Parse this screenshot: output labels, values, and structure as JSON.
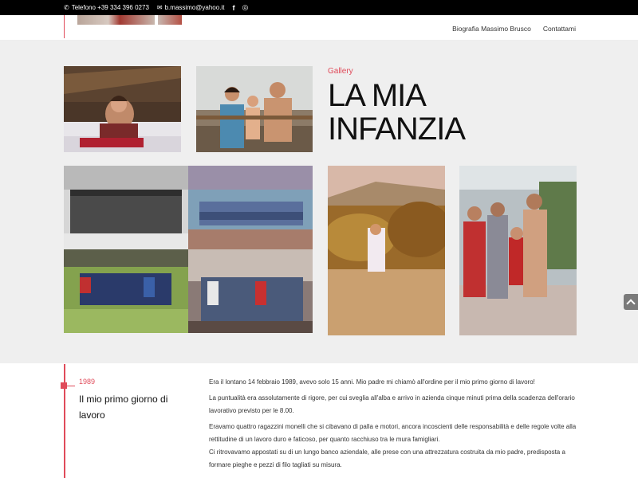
{
  "topbar": {
    "phone": "Telefono +39 334 396 0273",
    "email": "b.massimo@yahoo.it",
    "facebook_glyph": "f",
    "instagram_glyph": "◎"
  },
  "nav": {
    "items": [
      "Biografia Massimo Brusco",
      "Contattami"
    ]
  },
  "gallery": {
    "label": "Gallery",
    "title_line1": "LA MIA",
    "title_line2": "INFANZIA"
  },
  "section": {
    "year": "1989",
    "title": "Il mio primo giorno di lavoro",
    "paragraphs": [
      "Era il lontano 14 febbraio 1989, avevo solo 15 anni. Mio padre mi chiamò all'ordine per il mio primo giorno di lavoro!",
      "La puntualità era assolutamente di rigore, per cui sveglia all'alba e arrivo in azienda cinque minuti prima della scadenza dell'orario lavorativo previsto per le 8.00.",
      "Eravamo quattro ragazzini monelli che si cibavano di palla e motori, ancora incoscienti delle responsabilità e delle regole volte alla rettitudine di un lavoro duro e faticoso, per quanto racchiuso tra le mura famigliari.",
      "Ci ritrovavamo appostati su di un lungo banco aziendale, alle prese con una attrezzatura costruita da mio padre, predisposta a formare pieghe e pezzi di filo tagliati su misura."
    ]
  },
  "colors": {
    "accent": "#e04b5a",
    "topbar_bg": "#000000",
    "gallery_bg": "#efefef"
  }
}
